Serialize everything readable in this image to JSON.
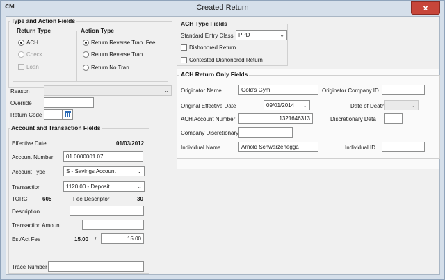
{
  "window": {
    "title": "Created Return",
    "app_icon": "CM",
    "close_glyph": "x"
  },
  "type_action": {
    "title": "Type and Action Fields",
    "return_type": {
      "title": "Return Type",
      "options": [
        {
          "label": "ACH",
          "checked": true,
          "enabled": true
        },
        {
          "label": "Check",
          "checked": false,
          "enabled": false
        },
        {
          "label": "Loan",
          "checked": false,
          "enabled": false
        }
      ]
    },
    "action_type": {
      "title": "Action Type",
      "options": [
        {
          "label": "Return  Reverse Tran. Fee",
          "checked": true
        },
        {
          "label": "Return  Reverse Tran",
          "checked": false
        },
        {
          "label": "Return  No Tran",
          "checked": false
        }
      ]
    }
  },
  "reason": {
    "label": "Reason",
    "value": ""
  },
  "override": {
    "label": "Override",
    "value": ""
  },
  "return_code": {
    "label": "Return Code",
    "value": ""
  },
  "account": {
    "title": "Account and Transaction Fields",
    "effective_date_label": "Effective Date",
    "effective_date_value": "01/03/2012",
    "account_number_label": "Account Number",
    "account_number_value": "01 0000001 07",
    "account_type_label": "Account Type",
    "account_type_value": "S - Savings Account",
    "transaction_label": "Transaction",
    "transaction_value": "1120.00 - Deposit",
    "torc_label": "TORC",
    "torc_value": "605",
    "fee_descriptor_label": "Fee Descriptor",
    "fee_descriptor_value": "30",
    "description_label": "Description",
    "description_value": "",
    "transaction_amount_label": "Transaction Amount",
    "transaction_amount_value": "",
    "est_act_fee_label": "Est/Act Fee",
    "est_fee_value": "15.00",
    "fee_separator": "/",
    "act_fee_value": "15.00",
    "trace_number_label": "Trace Number",
    "trace_number_value": ""
  },
  "ach_type": {
    "title": "ACH Type Fields",
    "sec_label": "Standard Entry Class",
    "sec_value": "PPD",
    "dishonored_label": "Dishonored Return",
    "contested_label": "Contested Dishonored Return"
  },
  "ach_return": {
    "title": "ACH Return Only Fields",
    "originator_name_label": "Originator Name",
    "originator_name_value": "Gold's Gym",
    "originator_company_id_label": "Originator Company ID",
    "originator_company_id_value": "",
    "orig_eff_date_label": "Original Effective Date",
    "orig_eff_date_value": "09/01/2014",
    "date_of_death_label": "Date of Death",
    "date_of_death_value": "",
    "ach_account_number_label": "ACH Account Number",
    "ach_account_number_value": "1321646313",
    "discretionary_data_label": "Discretionary Data",
    "discretionary_data_value": "",
    "company_discretionary_label": "Company Discretionary",
    "company_discretionary_value": "",
    "individual_name_label": "Individual Name",
    "individual_name_value": "Arnold Schwarzenegga",
    "individual_id_label": "Individual ID",
    "individual_id_value": ""
  },
  "icons": {
    "dropdown": "chevron-down-icon",
    "calendar": "calendar-icon",
    "close": "close-icon"
  },
  "colors": {
    "title_bar": "#d5dfea",
    "close_button": "#c7463a",
    "calendar_icon": "#2a6ab5"
  }
}
